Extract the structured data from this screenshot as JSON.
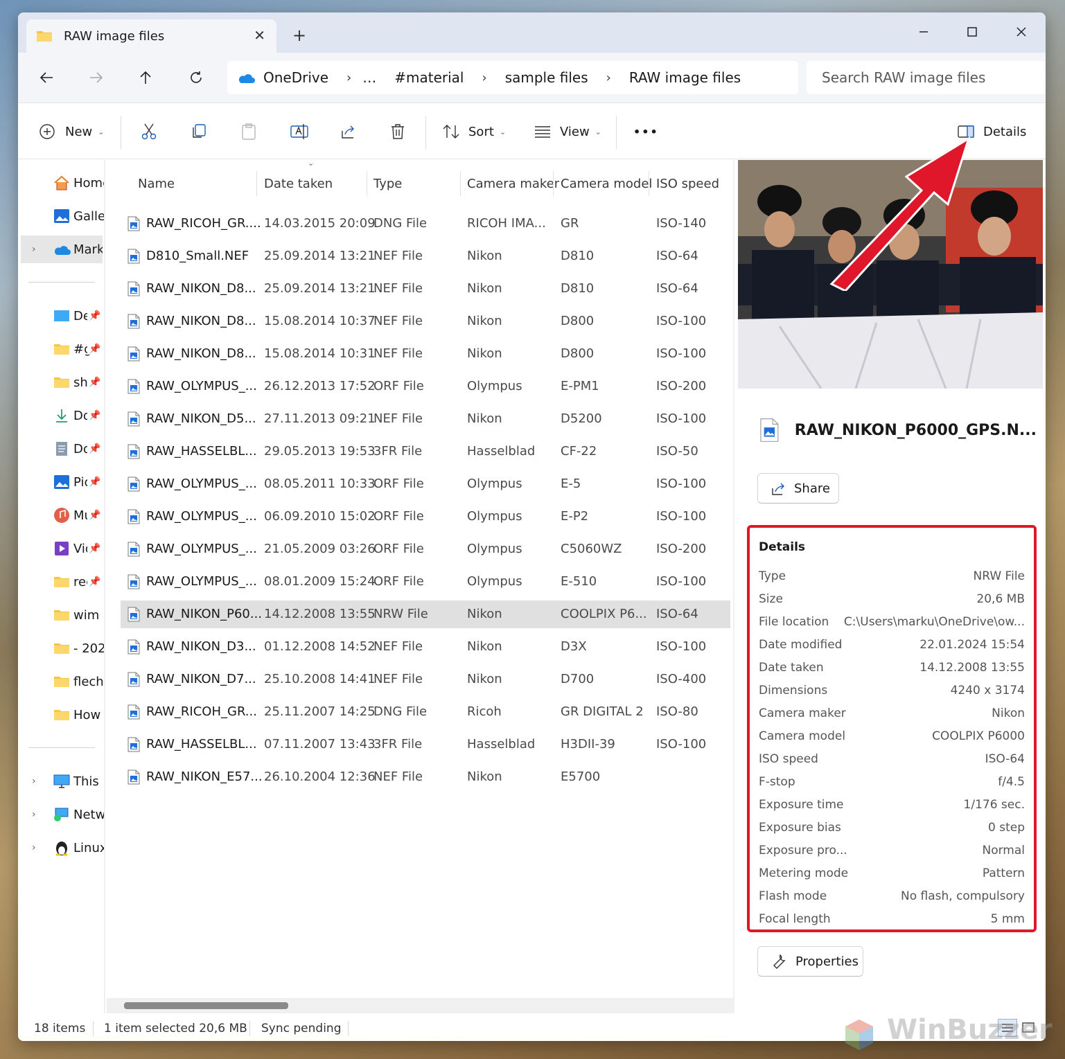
{
  "window": {
    "tab_title": "RAW image files",
    "new_tab": "+",
    "close_tab": "✕"
  },
  "address": {
    "crumbs": [
      "OneDrive",
      "…",
      "#material",
      "sample files",
      "RAW image files"
    ],
    "search_placeholder": "Search RAW image files"
  },
  "toolbar": {
    "new_label": "New",
    "sort_label": "Sort",
    "view_label": "View",
    "more_label": "•••",
    "details_label": "Details"
  },
  "sidebar": {
    "items": [
      {
        "label": "Home",
        "icon": "home-icon"
      },
      {
        "label": "Gallery",
        "icon": "gallery-icon"
      },
      {
        "label": "Marku",
        "icon": "onedrive-icon"
      },
      {
        "label": "De",
        "icon": "desktop-icon"
      },
      {
        "label": "#g",
        "icon": "folder-icon"
      },
      {
        "label": "sh",
        "icon": "folder-icon"
      },
      {
        "label": "Do",
        "icon": "download-icon"
      },
      {
        "label": "Do",
        "icon": "documents-icon"
      },
      {
        "label": "Pic",
        "icon": "pictures-icon"
      },
      {
        "label": "Mu",
        "icon": "music-icon"
      },
      {
        "label": "Vid",
        "icon": "video-icon"
      },
      {
        "label": "rec",
        "icon": "folder-icon"
      },
      {
        "label": "wim I",
        "icon": "folder-icon"
      },
      {
        "label": "- 202",
        "icon": "folder-icon"
      },
      {
        "label": "flecha",
        "icon": "folder-icon"
      },
      {
        "label": "How",
        "icon": "folder-icon"
      },
      {
        "label": "This PC",
        "icon": "this-pc-icon"
      },
      {
        "label": "Network",
        "icon": "network-icon"
      },
      {
        "label": "Linux",
        "icon": "linux-icon"
      }
    ]
  },
  "filelist": {
    "columns": [
      "Name",
      "Date taken",
      "Type",
      "Camera maker",
      "Camera model",
      "ISO speed"
    ],
    "rows": [
      [
        "RAW_RICOH_GR....",
        "14.03.2015 20:09",
        "DNG File",
        "RICOH IMA...",
        "GR",
        "ISO-140"
      ],
      [
        "D810_Small.NEF",
        "25.09.2014 13:21",
        "NEF File",
        "Nikon",
        "D810",
        "ISO-64"
      ],
      [
        "RAW_NIKON_D8...",
        "25.09.2014 13:21",
        "NEF File",
        "Nikon",
        "D810",
        "ISO-64"
      ],
      [
        "RAW_NIKON_D8...",
        "15.08.2014 10:37",
        "NEF File",
        "Nikon",
        "D800",
        "ISO-100"
      ],
      [
        "RAW_NIKON_D8...",
        "15.08.2014 10:31",
        "NEF File",
        "Nikon",
        "D800",
        "ISO-100"
      ],
      [
        "RAW_OLYMPUS_...",
        "26.12.2013 17:52",
        "ORF File",
        "Olympus",
        "E-PM1",
        "ISO-200"
      ],
      [
        "RAW_NIKON_D5...",
        "27.11.2013 09:21",
        "NEF File",
        "Nikon",
        "D5200",
        "ISO-100"
      ],
      [
        "RAW_HASSELBL...",
        "29.05.2013 19:53",
        "3FR File",
        "Hasselblad",
        "CF-22",
        "ISO-50"
      ],
      [
        "RAW_OLYMPUS_...",
        "08.05.2011 10:33",
        "ORF File",
        "Olympus",
        "E-5",
        "ISO-100"
      ],
      [
        "RAW_OLYMPUS_...",
        "06.09.2010 15:02",
        "ORF File",
        "Olympus",
        "E-P2",
        "ISO-100"
      ],
      [
        "RAW_OLYMPUS_...",
        "21.05.2009 03:26",
        "ORF File",
        "Olympus",
        "C5060WZ",
        "ISO-200"
      ],
      [
        "RAW_OLYMPUS_...",
        "08.01.2009 15:24",
        "ORF File",
        "Olympus",
        "E-510",
        "ISO-100"
      ],
      [
        "RAW_NIKON_P60...",
        "14.12.2008 13:55",
        "NRW File",
        "Nikon",
        "COOLPIX P6...",
        "ISO-64"
      ],
      [
        "RAW_NIKON_D3...",
        "01.12.2008 14:52",
        "NEF File",
        "Nikon",
        "D3X",
        "ISO-100"
      ],
      [
        "RAW_NIKON_D7...",
        "25.10.2008 14:41",
        "NEF File",
        "Nikon",
        "D700",
        "ISO-400"
      ],
      [
        "RAW_RICOH_GR...",
        "25.11.2007 14:25",
        "DNG File",
        "Ricoh",
        "GR DIGITAL 2",
        "ISO-80"
      ],
      [
        "RAW_HASSELBL...",
        "07.11.2007 13:43",
        "3FR File",
        "Hasselblad",
        "H3DII-39",
        "ISO-100"
      ],
      [
        "RAW_NIKON_E57...",
        "26.10.2004 12:36",
        "NEF File",
        "Nikon",
        "E5700",
        ""
      ]
    ],
    "selected_index": 12
  },
  "details": {
    "file_name": "RAW_NIKON_P6000_GPS.N...",
    "share_label": "Share",
    "section_title": "Details",
    "properties": [
      {
        "key": "Type",
        "value": "NRW File"
      },
      {
        "key": "Size",
        "value": "20,6 MB"
      },
      {
        "key": "File location",
        "value": "C:\\Users\\marku\\OneDrive\\ow..."
      },
      {
        "key": "Date modified",
        "value": "22.01.2024 15:54"
      },
      {
        "key": "Date taken",
        "value": "14.12.2008 13:55"
      },
      {
        "key": "Dimensions",
        "value": "4240 x 3174"
      },
      {
        "key": "Camera maker",
        "value": "Nikon"
      },
      {
        "key": "Camera model",
        "value": "COOLPIX P6000"
      },
      {
        "key": "ISO speed",
        "value": "ISO-64"
      },
      {
        "key": "F-stop",
        "value": "f/4.5"
      },
      {
        "key": "Exposure time",
        "value": "1/176 sec."
      },
      {
        "key": "Exposure bias",
        "value": "0 step"
      },
      {
        "key": "Exposure pro...",
        "value": "Normal"
      },
      {
        "key": "Metering mode",
        "value": "Pattern"
      },
      {
        "key": "Flash mode",
        "value": "No flash, compulsory"
      },
      {
        "key": "Focal length",
        "value": "5 mm"
      }
    ],
    "properties_label": "Properties",
    "highlight_color": "#e0162b"
  },
  "status": {
    "items_count": "18 items",
    "selection": "1 item selected  20,6 MB",
    "sync": "Sync pending"
  },
  "watermark": "WinBuzzer"
}
